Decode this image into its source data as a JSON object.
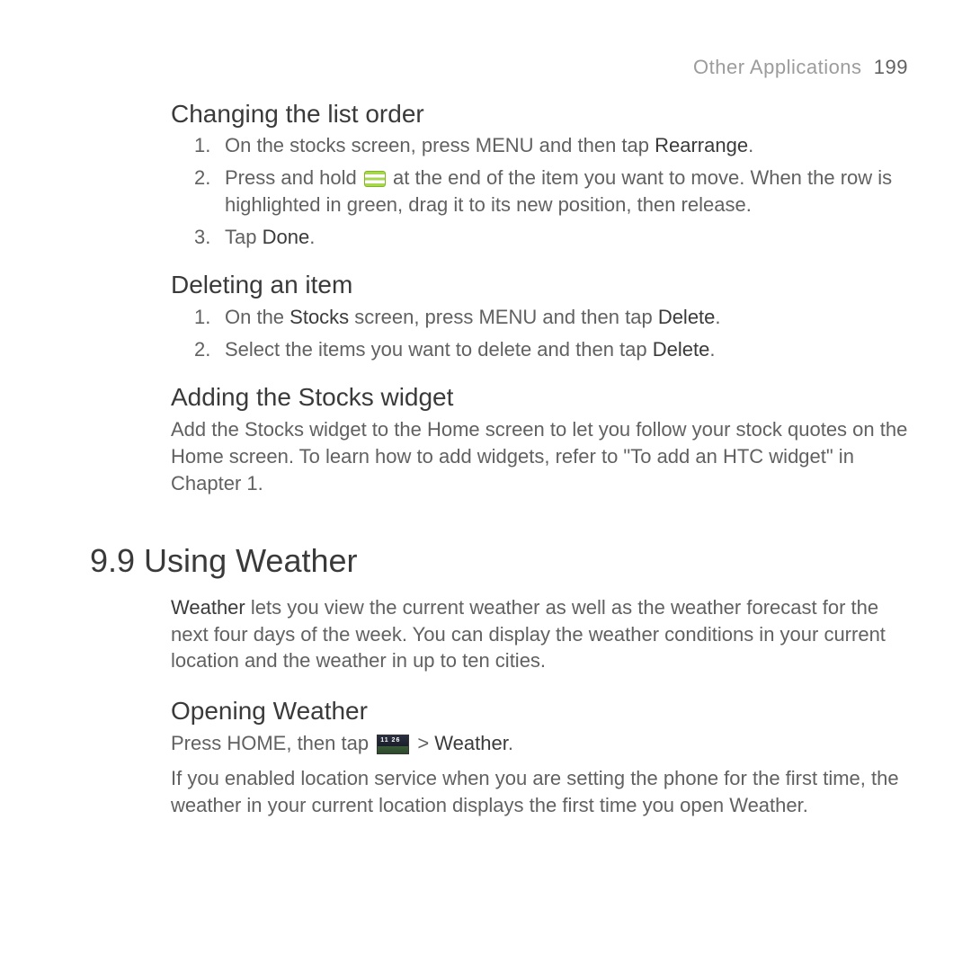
{
  "header": {
    "section_title": "Other Applications",
    "page_number": "199"
  },
  "s1": {
    "title": "Changing the list order",
    "items": {
      "n1": "1.",
      "t1a": "On the stocks screen, press MENU and then tap ",
      "t1b": "Rearrange",
      "t1c": ".",
      "n2": "2.",
      "t2a": "Press and hold ",
      "t2b": " at the end of the item you want to move. When the row is highlighted in green, drag it to its new position, then release.",
      "n3": "3.",
      "t3a": "Tap ",
      "t3b": "Done",
      "t3c": "."
    }
  },
  "s2": {
    "title": "Deleting an item",
    "items": {
      "n1": "1.",
      "t1a": "On the ",
      "t1b": "Stocks",
      "t1c": " screen, press MENU and then tap ",
      "t1d": "Delete",
      "t1e": ".",
      "n2": "2.",
      "t2a": "Select the items you want to delete and then tap ",
      "t2b": "Delete",
      "t2c": "."
    }
  },
  "s3": {
    "title": "Adding the Stocks widget",
    "body": "Add the Stocks widget to the Home screen to let you follow your stock quotes on the Home screen. To learn how to add widgets, refer to \"To add an HTC widget\" in Chapter 1."
  },
  "chapter": {
    "title": "9.9  Using Weather",
    "intro_a": "Weather",
    "intro_b": " lets you view the current weather as well as the weather forecast for the next four days of the week. You can display the weather conditions in your current location and the weather in up to ten cities."
  },
  "s4": {
    "title": "Opening Weather",
    "line1_a": "Press HOME, then tap ",
    "line1_b": " > ",
    "line1_c": "Weather",
    "line1_d": ".",
    "body2": "If you enabled location service when you are setting the phone for the first time, the weather in your current location displays the first time you open Weather."
  }
}
